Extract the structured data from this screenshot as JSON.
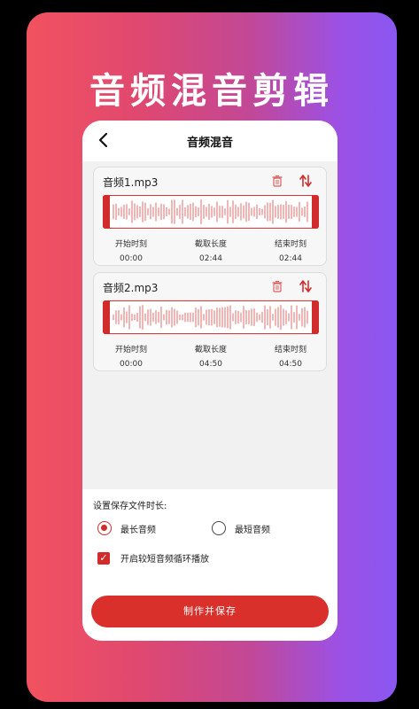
{
  "headline": "音频混音剪辑",
  "topbar": {
    "title": "音频混音",
    "back_icon": "chevron-left-icon"
  },
  "clips": [
    {
      "name": "音频1.mp3",
      "start_label": "开始时刻",
      "start": "00:00",
      "length_label": "截取长度",
      "length": "02:44",
      "end_label": "结束时刻",
      "end": "02:44"
    },
    {
      "name": "音频2.mp3",
      "start_label": "开始时刻",
      "start": "00:00",
      "length_label": "截取长度",
      "length": "04:50",
      "end_label": "结束时刻",
      "end": "04:50"
    }
  ],
  "icons": {
    "delete": "trash-icon",
    "swap": "swap-vertical-icon"
  },
  "settings": {
    "label": "设置保存文件时长:",
    "option_longest": "最长音频",
    "option_shortest": "最短音频",
    "selected": "最长音频",
    "loop_label": "开启较短音频循环播放",
    "loop_checked": true
  },
  "action": {
    "label": "制作并保存"
  },
  "colors": {
    "accent": "#d9302b",
    "gradient_start": "#f2525f",
    "gradient_end": "#8a57f2"
  }
}
